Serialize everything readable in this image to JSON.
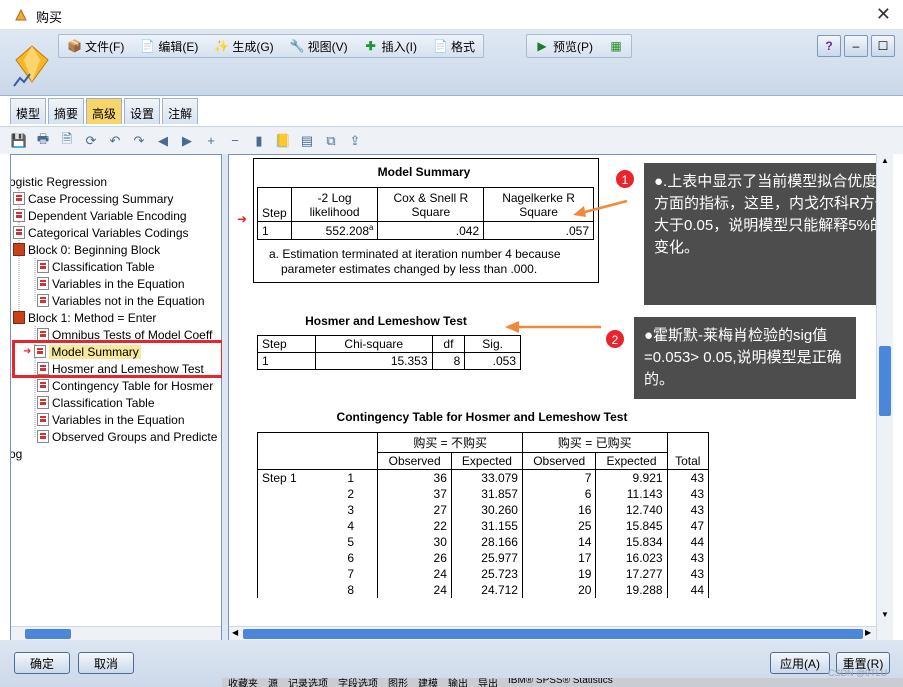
{
  "window": {
    "title": "购买"
  },
  "menu": {
    "items": [
      {
        "label": "文件(F)",
        "icon": "file-icon"
      },
      {
        "label": "编辑(E)",
        "icon": "edit-icon"
      },
      {
        "label": "生成(G)",
        "icon": "generate-icon"
      },
      {
        "label": "视图(V)",
        "icon": "view-icon"
      },
      {
        "label": "插入(I)",
        "icon": "insert-icon"
      },
      {
        "label": "格式",
        "icon": "format-icon"
      }
    ],
    "preview": "预览(P)"
  },
  "tabs": [
    "模型",
    "摘要",
    "高级",
    "设置",
    "注解"
  ],
  "active_tab": "高级",
  "tree": {
    "root": "ogistic Regression",
    "items": [
      "Case Processing Summary",
      "Dependent Variable Encoding",
      "Categorical Variables Codings",
      "Block 0: Beginning Block",
      "Classification Table",
      "Variables in the Equation",
      "Variables not in the Equation",
      "Block 1: Method = Enter",
      "Omnibus Tests of Model Coeff",
      "Model Summary",
      "Hosmer and Lemeshow Test",
      "Contingency Table for Hosmer",
      "Classification Table",
      "Variables in the Equation",
      "Observed Groups and Predicte"
    ],
    "log": "og"
  },
  "model_summary": {
    "title": "Model Summary",
    "headers": [
      "Step",
      "-2 Log likelihood",
      "Cox & Snell R Square",
      "Nagelkerke R Square"
    ],
    "row": [
      "1",
      "552.208",
      ".042",
      ".057"
    ],
    "sup": "a",
    "note_line1": "a. Estimation terminated at iteration number 4 because",
    "note_line2": "parameter estimates changed by less than .000."
  },
  "hosmer": {
    "title": "Hosmer and Lemeshow Test",
    "headers": [
      "Step",
      "Chi-square",
      "df",
      "Sig."
    ],
    "row": [
      "1",
      "15.353",
      "8",
      ".053"
    ]
  },
  "contingency": {
    "title": "Contingency Table for Hosmer and Lemeshow Test",
    "group1": "购买 = 不购买",
    "group2": "购买 = 已购买",
    "sub": [
      "Observed",
      "Expected",
      "Observed",
      "Expected"
    ],
    "total": "Total",
    "step_label": "Step 1",
    "rows": [
      [
        "1",
        "36",
        "33.079",
        "7",
        "9.921",
        "43"
      ],
      [
        "2",
        "37",
        "31.857",
        "6",
        "11.143",
        "43"
      ],
      [
        "3",
        "27",
        "30.260",
        "16",
        "12.740",
        "43"
      ],
      [
        "4",
        "22",
        "31.155",
        "25",
        "15.845",
        "47"
      ],
      [
        "5",
        "30",
        "28.166",
        "14",
        "15.834",
        "44"
      ],
      [
        "6",
        "26",
        "25.977",
        "17",
        "16.023",
        "43"
      ],
      [
        "7",
        "24",
        "25.723",
        "19",
        "17.277",
        "43"
      ],
      [
        "8",
        "24",
        "24.712",
        "20",
        "19.288",
        "44"
      ]
    ]
  },
  "callouts": [
    {
      "badge": "1",
      "text": "●.上表中显示了当前模型拟合优度方面的指标，这里，内戈尔科R方值大于0.05，说明模型只能解释5%的变化。"
    },
    {
      "badge": "2",
      "text": "●霍斯默-莱梅肖检验的sig值=0.053> 0.05,说明模型是正确的。"
    }
  ],
  "footer": {
    "ok": "确定",
    "cancel": "取消",
    "apply": "应用(A)",
    "reset": "重置(R)"
  },
  "taskbar": [
    "收藏夹",
    "源",
    "记录选项",
    "字段选项",
    "图形",
    "建模",
    "输出",
    "导出",
    "IBM® SPSS® Statistics"
  ],
  "watermark": "CSDN @9TLU"
}
